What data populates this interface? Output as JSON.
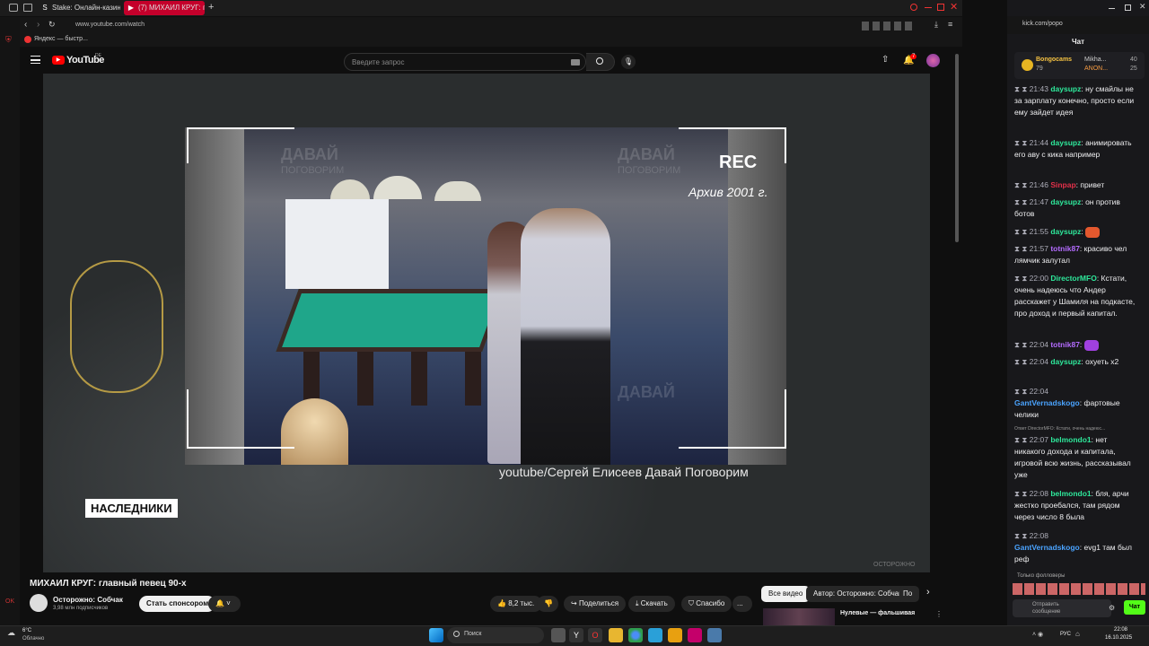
{
  "tabs": [
    {
      "label": "Stake: Онлайн-казино и"
    },
    {
      "label": "(7) МИХАИЛ КРУГ: г"
    }
  ],
  "address": {
    "left_url": "www.youtube.com/watch",
    "right_url": "kick.com/popo"
  },
  "bookmark": {
    "label": "Яндекс — быстр..."
  },
  "youtube": {
    "logo": "YouTube",
    "region": "DE",
    "search_placeholder": "Введите запрос",
    "notif_count": "7"
  },
  "video": {
    "rec": "REC",
    "archive": "Архив 2001 г.",
    "source": "youtube/Сергей Елисеев Давай Поговорим",
    "label": "НАСЛЕДНИКИ",
    "watermark": "ДАВАЙ",
    "watermark2": "ПОГОВОРИМ",
    "corner_logo": "ОСТОРОЖНО"
  },
  "meta": {
    "title": "МИХАИЛ КРУГ: главный певец 90-х",
    "channel": "Осторожно: Собчак",
    "subs": "3,98 млн подписчиков",
    "sponsor": "Стать спонсором",
    "likes": "8,2 тыс.",
    "share": "Поделиться",
    "download": "Скачать",
    "thanks": "Спасибо",
    "more": "..."
  },
  "filters": [
    "Все видео",
    "Автор: Осторожно: Собчак",
    "По"
  ],
  "rec_video": {
    "title": "Нулевые — фальшивая"
  },
  "chat": {
    "title": "Чат",
    "top": {
      "name": "Bongocams",
      "amount": "79",
      "user1": "Mikha...",
      "val1": "40",
      "user2": "ANON...",
      "val2": "25"
    },
    "messages": [
      {
        "time": "21:43",
        "user": "daysupz",
        "color": "#2ee89b",
        "text": "ну смайлы не за зарплату конечно, просто если ему зайдет идея"
      },
      {
        "time": "21:44",
        "user": "daysupz",
        "color": "#2ee89b",
        "text": "анимировать его аву с кика например"
      },
      {
        "time": "21:46",
        "user": "Sinpap",
        "color": "#e3304a",
        "text": "привет"
      },
      {
        "time": "21:47",
        "user": "daysupz",
        "color": "#2ee89b",
        "text": "он против ботов"
      },
      {
        "time": "21:55",
        "user": "daysupz",
        "color": "#2ee89b",
        "text": ""
      },
      {
        "time": "21:57",
        "user": "totnik87",
        "color": "#b46cff",
        "text": "красиво чел лямчик залутал"
      },
      {
        "time": "22:00",
        "user": "DirectorMFO",
        "color": "#2ee89b",
        "text": "Кстати, очень надеюсь что Андер расскажет у Шамиля на подкасте, про доход и первый капитал."
      },
      {
        "time": "22:04",
        "user": "totnik87",
        "color": "#b46cff",
        "text": ""
      },
      {
        "time": "22:04",
        "user": "daysupz",
        "color": "#2ee89b",
        "text": "охуеть х2"
      },
      {
        "time": "22:04",
        "user": "GantVernadskogo",
        "color": "#4aa3ff",
        "text": "фартовые челики"
      },
      {
        "time": "22:07",
        "user": "belmondo1",
        "color": "#2ee89b",
        "text": "нет никакого дохода и капитала, игровой всю жизнь, рассказывал уже",
        "reply": "Ответ DirectorMFO: Кстати, очень надеюс..."
      },
      {
        "time": "22:08",
        "user": "belmondo1",
        "color": "#2ee89b",
        "text": "бля, арчи жестко проебался, там рядом через число 8 была"
      },
      {
        "time": "22:08",
        "user": "GantVernadskogo",
        "color": "#4aa3ff",
        "text": "evg1 там был реф"
      }
    ],
    "followers_only": "Только фолловеры",
    "send": "Отправить сообщение",
    "chat_btn": "Чат"
  },
  "taskbar": {
    "temp": "6°C",
    "weather": "Облачно",
    "search": "Поиск",
    "lang": "РУС",
    "time": "22:08",
    "date": "16.10.2025"
  },
  "colors": {
    "accent": "#53fc18",
    "yt_red": "#ff0000",
    "chat_bg": "#18181b"
  }
}
